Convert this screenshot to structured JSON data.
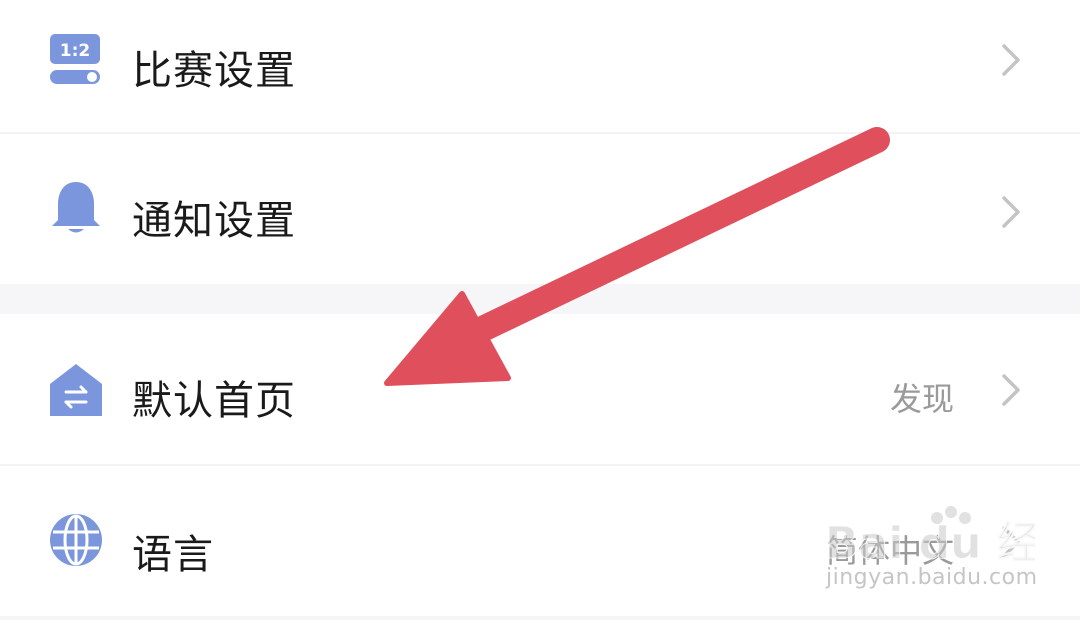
{
  "settings": {
    "items": [
      {
        "label": "比赛设置",
        "value": "",
        "icon": "match-ratio-toggle-icon"
      },
      {
        "label": "通知设置",
        "value": "",
        "icon": "bell-icon"
      },
      {
        "label": "默认首页",
        "value": "发现",
        "icon": "home-switch-icon"
      },
      {
        "label": "语言",
        "value": "简体中文",
        "icon": "globe-icon"
      }
    ],
    "match_icon_text": "1:2"
  },
  "watermark": {
    "brand": "Bai du 经验",
    "url": "jingyan.baidu.com"
  },
  "colors": {
    "icon_blue": "#7b96dc",
    "arrow_red": "#e0505c",
    "chevron_gray": "#c4c4c4",
    "value_gray": "#9a9a9a",
    "label_black": "#1a1a1a",
    "section_gap": "#f6f6f8"
  }
}
